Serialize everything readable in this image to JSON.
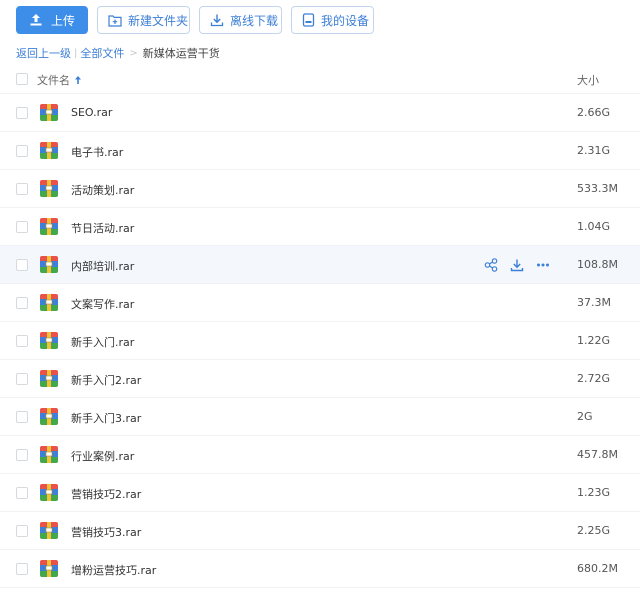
{
  "toolbar": {
    "upload_label": "上传",
    "new_folder_label": "新建文件夹",
    "offline_download_label": "离线下载",
    "my_devices_label": "我的设备"
  },
  "breadcrumb": {
    "back_label": "返回上一级",
    "all_files_label": "全部文件",
    "sep_symbol": ">",
    "current_label": "新媒体运营干货"
  },
  "list_header": {
    "name_label": "文件名",
    "size_label": "大小"
  },
  "files": [
    {
      "name": "SEO.rar",
      "size": "2.66G"
    },
    {
      "name": "电子书.rar",
      "size": "2.31G"
    },
    {
      "name": "活动策划.rar",
      "size": "533.3M"
    },
    {
      "name": "节日活动.rar",
      "size": "1.04G"
    },
    {
      "name": "内部培训.rar",
      "size": "108.8M"
    },
    {
      "name": "文案写作.rar",
      "size": "37.3M"
    },
    {
      "name": "新手入门.rar",
      "size": "1.22G"
    },
    {
      "name": "新手入门2.rar",
      "size": "2.72G"
    },
    {
      "name": "新手入门3.rar",
      "size": "2G"
    },
    {
      "name": "行业案例.rar",
      "size": "457.8M"
    },
    {
      "name": "营销技巧2.rar",
      "size": "1.23G"
    },
    {
      "name": "营销技巧3.rar",
      "size": "2.25G"
    },
    {
      "name": "增粉运营技巧.rar",
      "size": "680.2M"
    }
  ],
  "hover_row_index": 4,
  "colors": {
    "accent": "#3c8ee9",
    "link": "#3c7fd6",
    "hover_row_bg": "#f4f8fd"
  },
  "icons": {
    "upload": "upload-icon",
    "new_folder": "folder-plus-icon",
    "offline_download": "download-icon",
    "my_devices": "device-icon",
    "sort": "sort-asc-icon",
    "file": "rar-archive-icon",
    "share": "share-icon",
    "download": "download-icon",
    "more": "more-icon"
  }
}
